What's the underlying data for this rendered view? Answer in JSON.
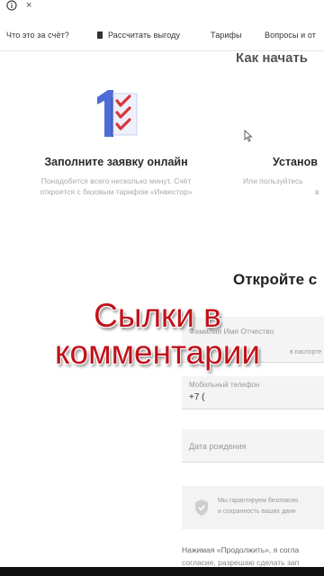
{
  "nav": {
    "items": [
      {
        "label": "Что это за счёт?"
      },
      {
        "label": "Рассчитать выгоду"
      },
      {
        "label": "Тарифы"
      },
      {
        "label": "Вопросы и от"
      }
    ]
  },
  "section": {
    "title": "Как начать"
  },
  "steps": [
    {
      "title": "Заполните заявку онлайн",
      "sub1": "Понадобится всего несколько минут. Счёт",
      "sub2": "откроется с базовым тарифом «Инвестор»",
      "icon": "checklist-icon",
      "icon_number": "1"
    },
    {
      "title": "Установ",
      "sub1": "Или пользуйтесь",
      "sub2": "в"
    }
  ],
  "form": {
    "title": "Откройте с",
    "fields": {
      "name": {
        "label": "Фамилия Имя Отчество",
        "hint": "в паспорте"
      },
      "phone": {
        "label": "Мобильный телефон",
        "value": "+7 ("
      },
      "birth": {
        "label": "Дата рождения"
      }
    },
    "notice": {
      "line1": "Мы гарантируем безопасно",
      "line2": "и сохранность ваших данн",
      "icon": "shield-icon"
    },
    "consent_line1": "Нажимая «Продолжить», я согла",
    "consent_line2": "согласие, разрешаю сделать зап"
  },
  "overlay": {
    "line1": "Сылки в",
    "line2": "комментарии",
    "color": "#c0121a"
  },
  "colors": {
    "icon_blue": "#4f6bd8",
    "icon_red": "#d9363e"
  }
}
